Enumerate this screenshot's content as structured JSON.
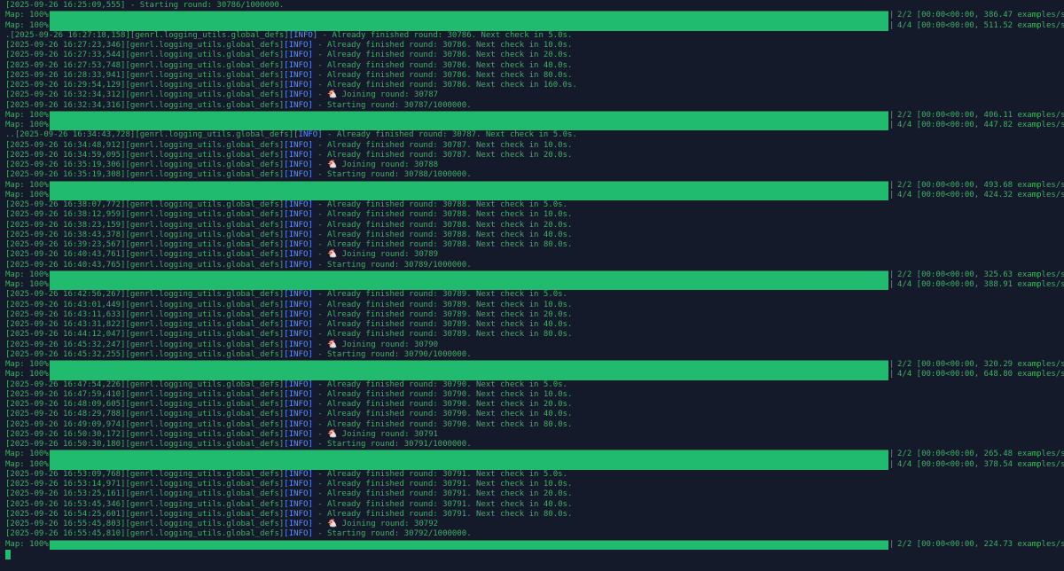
{
  "colors": {
    "background": "#141a2a",
    "text": "#3fae66",
    "tag": "#5b8cff",
    "bar": "#20bb6e"
  },
  "lines": [
    {
      "type": "log",
      "ts": "[2025-09-26 16:25:09,555]",
      "logger": "",
      "level": "",
      "msg": " - Starting round: 30786/1000000."
    },
    {
      "type": "map",
      "label": "Map: 100%|",
      "stats": "2/2 [00:00<00:00, 386.47 examples/s]",
      "first": true
    },
    {
      "type": "map",
      "label": "Map: 100%|",
      "stats": "4/4 [00:00<00:00, 511.52 examples/s]",
      "first": false
    },
    {
      "type": "log",
      "ts": ".[2025-09-26 16:27:18,158]",
      "logger": "[genrl.logging_utils.global_defs]",
      "level": "[INFO]",
      "msg": " - Already finished round: 30786. Next check in 5.0s."
    },
    {
      "type": "log",
      "ts": "[2025-09-26 16:27:23,346]",
      "logger": "[genrl.logging_utils.global_defs]",
      "level": "[INFO]",
      "msg": " - Already finished round: 30786. Next check in 10.0s."
    },
    {
      "type": "log",
      "ts": "[2025-09-26 16:27:33,544]",
      "logger": "[genrl.logging_utils.global_defs]",
      "level": "[INFO]",
      "msg": " - Already finished round: 30786. Next check in 20.0s."
    },
    {
      "type": "log",
      "ts": "[2025-09-26 16:27:53,748]",
      "logger": "[genrl.logging_utils.global_defs]",
      "level": "[INFO]",
      "msg": " - Already finished round: 30786. Next check in 40.0s."
    },
    {
      "type": "log",
      "ts": "[2025-09-26 16:28:33,941]",
      "logger": "[genrl.logging_utils.global_defs]",
      "level": "[INFO]",
      "msg": " - Already finished round: 30786. Next check in 80.0s."
    },
    {
      "type": "log",
      "ts": "[2025-09-26 16:29:54,129]",
      "logger": "[genrl.logging_utils.global_defs]",
      "level": "[INFO]",
      "msg": " - Already finished round: 30786. Next check in 160.0s."
    },
    {
      "type": "log",
      "ts": "[2025-09-26 16:32:34,312]",
      "logger": "[genrl.logging_utils.global_defs]",
      "level": "[INFO]",
      "msg": " - 🐔 Joining round: 30787"
    },
    {
      "type": "log",
      "ts": "[2025-09-26 16:32:34,316]",
      "logger": "[genrl.logging_utils.global_defs]",
      "level": "[INFO]",
      "msg": " - Starting round: 30787/1000000."
    },
    {
      "type": "map",
      "label": "Map: 100%|",
      "stats": "2/2 [00:00<00:00, 406.11 examples/s]",
      "first": true
    },
    {
      "type": "map",
      "label": "Map: 100%|",
      "stats": "4/4 [00:00<00:00, 447.82 examples/s]",
      "first": false
    },
    {
      "type": "log",
      "ts": "..[2025-09-26 16:34:43,728]",
      "logger": "[genrl.logging_utils.global_defs]",
      "level": "[INFO]",
      "msg": " - Already finished round: 30787. Next check in 5.0s."
    },
    {
      "type": "log",
      "ts": "[2025-09-26 16:34:48,912]",
      "logger": "[genrl.logging_utils.global_defs]",
      "level": "[INFO]",
      "msg": " - Already finished round: 30787. Next check in 10.0s."
    },
    {
      "type": "log",
      "ts": "[2025-09-26 16:34:59,095]",
      "logger": "[genrl.logging_utils.global_defs]",
      "level": "[INFO]",
      "msg": " - Already finished round: 30787. Next check in 20.0s."
    },
    {
      "type": "log",
      "ts": "[2025-09-26 16:35:19,306]",
      "logger": "[genrl.logging_utils.global_defs]",
      "level": "[INFO]",
      "msg": " - 🐔 Joining round: 30788"
    },
    {
      "type": "log",
      "ts": "[2025-09-26 16:35:19,308]",
      "logger": "[genrl.logging_utils.global_defs]",
      "level": "[INFO]",
      "msg": " - Starting round: 30788/1000000."
    },
    {
      "type": "map",
      "label": "Map: 100%|",
      "stats": "2/2 [00:00<00:00, 493.68 examples/s]",
      "first": true
    },
    {
      "type": "map",
      "label": "Map: 100%|",
      "stats": "4/4 [00:00<00:00, 424.32 examples/s]",
      "first": false
    },
    {
      "type": "log",
      "ts": "[2025-09-26 16:38:07,772]",
      "logger": "[genrl.logging_utils.global_defs]",
      "level": "[INFO]",
      "msg": " - Already finished round: 30788. Next check in 5.0s."
    },
    {
      "type": "log",
      "ts": "[2025-09-26 16:38:12,959]",
      "logger": "[genrl.logging_utils.global_defs]",
      "level": "[INFO]",
      "msg": " - Already finished round: 30788. Next check in 10.0s."
    },
    {
      "type": "log",
      "ts": "[2025-09-26 16:38:23,159]",
      "logger": "[genrl.logging_utils.global_defs]",
      "level": "[INFO]",
      "msg": " - Already finished round: 30788. Next check in 20.0s."
    },
    {
      "type": "log",
      "ts": "[2025-09-26 16:38:43,378]",
      "logger": "[genrl.logging_utils.global_defs]",
      "level": "[INFO]",
      "msg": " - Already finished round: 30788. Next check in 40.0s."
    },
    {
      "type": "log",
      "ts": "[2025-09-26 16:39:23,567]",
      "logger": "[genrl.logging_utils.global_defs]",
      "level": "[INFO]",
      "msg": " - Already finished round: 30788. Next check in 80.0s."
    },
    {
      "type": "log",
      "ts": "[2025-09-26 16:40:43,761]",
      "logger": "[genrl.logging_utils.global_defs]",
      "level": "[INFO]",
      "msg": " - 🐔 Joining round: 30789"
    },
    {
      "type": "log",
      "ts": "[2025-09-26 16:40:43,765]",
      "logger": "[genrl.logging_utils.global_defs]",
      "level": "[INFO]",
      "msg": " - Starting round: 30789/1000000."
    },
    {
      "type": "map",
      "label": "Map: 100%|",
      "stats": "2/2 [00:00<00:00, 325.63 examples/s]",
      "first": true
    },
    {
      "type": "map",
      "label": "Map: 100%|",
      "stats": "4/4 [00:00<00:00, 388.91 examples/s]",
      "first": false
    },
    {
      "type": "log",
      "ts": "[2025-09-26 16:42:56,267]",
      "logger": "[genrl.logging_utils.global_defs]",
      "level": "[INFO]",
      "msg": " - Already finished round: 30789. Next check in 5.0s."
    },
    {
      "type": "log",
      "ts": "[2025-09-26 16:43:01,449]",
      "logger": "[genrl.logging_utils.global_defs]",
      "level": "[INFO]",
      "msg": " - Already finished round: 30789. Next check in 10.0s."
    },
    {
      "type": "log",
      "ts": "[2025-09-26 16:43:11,633]",
      "logger": "[genrl.logging_utils.global_defs]",
      "level": "[INFO]",
      "msg": " - Already finished round: 30789. Next check in 20.0s."
    },
    {
      "type": "log",
      "ts": "[2025-09-26 16:43:31,822]",
      "logger": "[genrl.logging_utils.global_defs]",
      "level": "[INFO]",
      "msg": " - Already finished round: 30789. Next check in 40.0s."
    },
    {
      "type": "log",
      "ts": "[2025-09-26 16:44:12,047]",
      "logger": "[genrl.logging_utils.global_defs]",
      "level": "[INFO]",
      "msg": " - Already finished round: 30789. Next check in 80.0s."
    },
    {
      "type": "log",
      "ts": "[2025-09-26 16:45:32,247]",
      "logger": "[genrl.logging_utils.global_defs]",
      "level": "[INFO]",
      "msg": " - 🐔 Joining round: 30790"
    },
    {
      "type": "log",
      "ts": "[2025-09-26 16:45:32,255]",
      "logger": "[genrl.logging_utils.global_defs]",
      "level": "[INFO]",
      "msg": " - Starting round: 30790/1000000."
    },
    {
      "type": "map",
      "label": "Map: 100%|",
      "stats": "2/2 [00:00<00:00, 320.29 examples/s]",
      "first": true
    },
    {
      "type": "map",
      "label": "Map: 100%|",
      "stats": "4/4 [00:00<00:00, 648.80 examples/s]",
      "first": false
    },
    {
      "type": "log",
      "ts": "[2025-09-26 16:47:54,226]",
      "logger": "[genrl.logging_utils.global_defs]",
      "level": "[INFO]",
      "msg": " - Already finished round: 30790. Next check in 5.0s."
    },
    {
      "type": "log",
      "ts": "[2025-09-26 16:47:59,410]",
      "logger": "[genrl.logging_utils.global_defs]",
      "level": "[INFO]",
      "msg": " - Already finished round: 30790. Next check in 10.0s."
    },
    {
      "type": "log",
      "ts": "[2025-09-26 16:48:09,605]",
      "logger": "[genrl.logging_utils.global_defs]",
      "level": "[INFO]",
      "msg": " - Already finished round: 30790. Next check in 20.0s."
    },
    {
      "type": "log",
      "ts": "[2025-09-26 16:48:29,788]",
      "logger": "[genrl.logging_utils.global_defs]",
      "level": "[INFO]",
      "msg": " - Already finished round: 30790. Next check in 40.0s."
    },
    {
      "type": "log",
      "ts": "[2025-09-26 16:49:09,974]",
      "logger": "[genrl.logging_utils.global_defs]",
      "level": "[INFO]",
      "msg": " - Already finished round: 30790. Next check in 80.0s."
    },
    {
      "type": "log",
      "ts": "[2025-09-26 16:50:30,172]",
      "logger": "[genrl.logging_utils.global_defs]",
      "level": "[INFO]",
      "msg": " - 🐔 Joining round: 30791"
    },
    {
      "type": "log",
      "ts": "[2025-09-26 16:50:30,180]",
      "logger": "[genrl.logging_utils.global_defs]",
      "level": "[INFO]",
      "msg": " - Starting round: 30791/1000000."
    },
    {
      "type": "map",
      "label": "Map: 100%|",
      "stats": "2/2 [00:00<00:00, 265.48 examples/s]",
      "first": true
    },
    {
      "type": "map",
      "label": "Map: 100%|",
      "stats": "4/4 [00:00<00:00, 378.54 examples/s]",
      "first": false
    },
    {
      "type": "log",
      "ts": "[2025-09-26 16:53:09,768]",
      "logger": "[genrl.logging_utils.global_defs]",
      "level": "[INFO]",
      "msg": " - Already finished round: 30791. Next check in 5.0s."
    },
    {
      "type": "log",
      "ts": "[2025-09-26 16:53:14,971]",
      "logger": "[genrl.logging_utils.global_defs]",
      "level": "[INFO]",
      "msg": " - Already finished round: 30791. Next check in 10.0s."
    },
    {
      "type": "log",
      "ts": "[2025-09-26 16:53:25,161]",
      "logger": "[genrl.logging_utils.global_defs]",
      "level": "[INFO]",
      "msg": " - Already finished round: 30791. Next check in 20.0s."
    },
    {
      "type": "log",
      "ts": "[2025-09-26 16:53:45,346]",
      "logger": "[genrl.logging_utils.global_defs]",
      "level": "[INFO]",
      "msg": " - Already finished round: 30791. Next check in 40.0s."
    },
    {
      "type": "log",
      "ts": "[2025-09-26 16:54:25,601]",
      "logger": "[genrl.logging_utils.global_defs]",
      "level": "[INFO]",
      "msg": " - Already finished round: 30791. Next check in 80.0s."
    },
    {
      "type": "log",
      "ts": "[2025-09-26 16:55:45,803]",
      "logger": "[genrl.logging_utils.global_defs]",
      "level": "[INFO]",
      "msg": " - 🐔 Joining round: 30792"
    },
    {
      "type": "log",
      "ts": "[2025-09-26 16:55:45,810]",
      "logger": "[genrl.logging_utils.global_defs]",
      "level": "[INFO]",
      "msg": " - Starting round: 30792/1000000."
    },
    {
      "type": "map",
      "label": "Map: 100%|",
      "stats": "2/2 [00:00<00:00, 224.73 examples/s]",
      "first": true
    }
  ]
}
